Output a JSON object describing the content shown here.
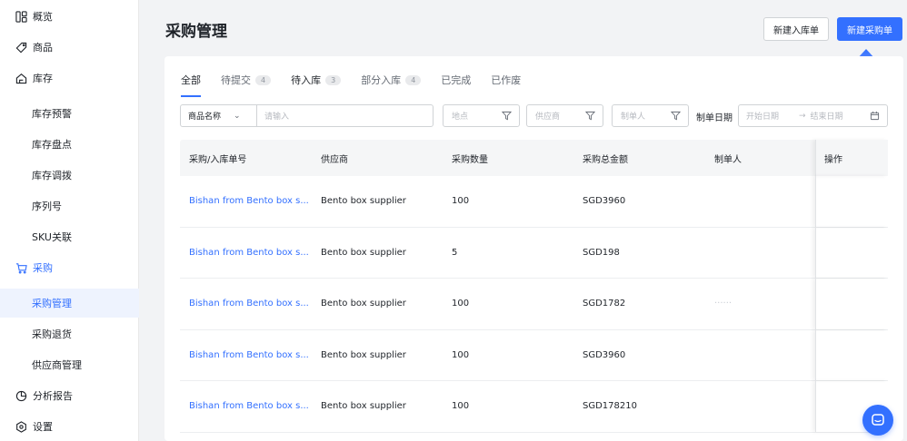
{
  "sidebar": {
    "items": [
      {
        "label": "概览",
        "icon": "dashboard-icon"
      },
      {
        "label": "商品",
        "icon": "tag-icon"
      },
      {
        "label": "库存",
        "icon": "home-icon"
      },
      {
        "label": "库存预警"
      },
      {
        "label": "库存盘点"
      },
      {
        "label": "库存调拨"
      },
      {
        "label": "序列号"
      },
      {
        "label": "SKU关联"
      },
      {
        "label": "采购",
        "icon": "cart-icon"
      },
      {
        "label": "采购管理"
      },
      {
        "label": "采购退货"
      },
      {
        "label": "供应商管理"
      },
      {
        "label": "分析报告",
        "icon": "pie-chart-icon"
      },
      {
        "label": "设置",
        "icon": "settings-icon"
      }
    ]
  },
  "header": {
    "title": "采购管理",
    "new_inbound_label": "新建入库单",
    "new_purchase_label": "新建采购单"
  },
  "tabs": [
    {
      "label": "全部",
      "count": ""
    },
    {
      "label": "待提交",
      "count": "4"
    },
    {
      "label": "待入库",
      "count": "3"
    },
    {
      "label": "部分入库",
      "count": "4"
    },
    {
      "label": "已完成",
      "count": ""
    },
    {
      "label": "已作废",
      "count": ""
    }
  ],
  "filters": {
    "field_select": "商品名称",
    "search_placeholder": "请输入",
    "location_placeholder": "地点",
    "supplier_placeholder": "供应商",
    "maker_placeholder": "制单人",
    "date_label": "制单日期",
    "start_placeholder": "开始日期",
    "end_placeholder": "结束日期"
  },
  "table": {
    "columns": [
      "采购/入库单号",
      "供应商",
      "采购数量",
      "采购总金额",
      "制单人",
      "操作"
    ],
    "rows": [
      {
        "order": "Bishan from Bento box s...",
        "supplier": "Bento box supplier",
        "qty": "100",
        "amount": "SGD3960",
        "maker": ""
      },
      {
        "order": "Bishan from Bento box s...",
        "supplier": "Bento box supplier",
        "qty": "5",
        "amount": "SGD198",
        "maker": ""
      },
      {
        "order": "Bishan from Bento box s...",
        "supplier": "Bento box supplier",
        "qty": "100",
        "amount": "SGD1782",
        "maker": "······"
      },
      {
        "order": "Bishan from Bento box s...",
        "supplier": "Bento box supplier",
        "qty": "100",
        "amount": "SGD3960",
        "maker": ""
      },
      {
        "order": "Bishan from Bento box s...",
        "supplier": "Bento box supplier",
        "qty": "100",
        "amount": "SGD178210",
        "maker": ""
      }
    ]
  },
  "colors": {
    "primary": "#3370ff",
    "selected_bg": "#eef3fe",
    "text": "#1f2329",
    "muted": "#8f959e"
  }
}
